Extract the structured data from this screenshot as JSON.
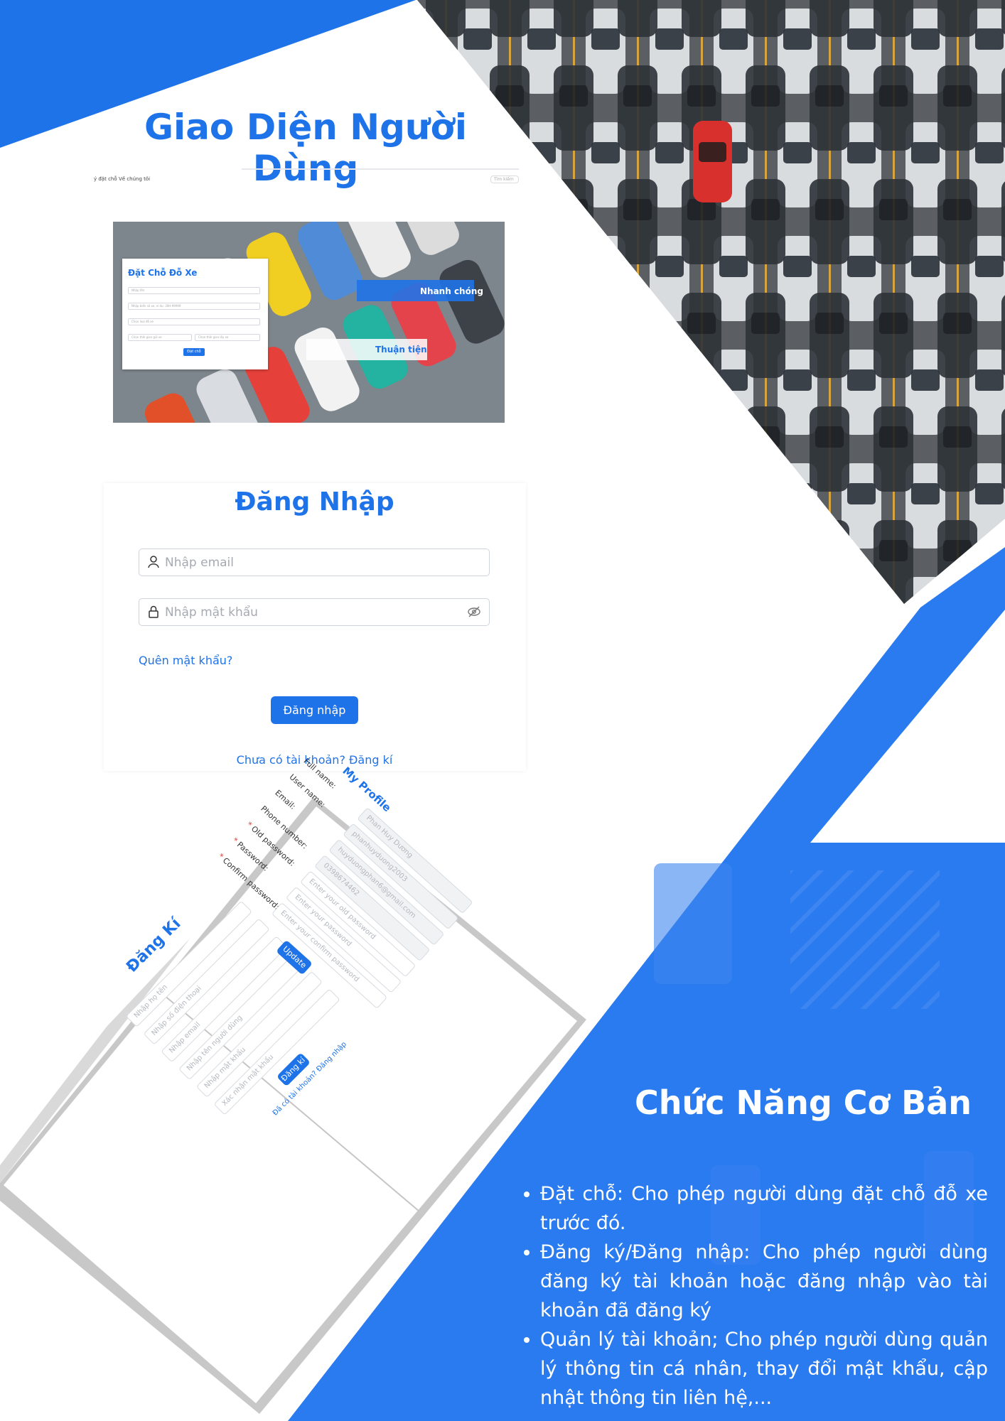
{
  "page_title": "Giao Diện Người Dùng",
  "colors": {
    "brand": "#1f73e9",
    "brand_band": "#2a7af0",
    "white": "#ffffff"
  },
  "nav": {
    "left_item_1": "ý đặt chỗ",
    "left_item_2": "Về chúng tôi",
    "search_placeholder": "Tìm kiếm"
  },
  "hero": {
    "form_title": "Đặt Chỗ Đỗ Xe",
    "field_1": "Nhập tên",
    "field_2": "Nhập biển số xe, ví dụ: 30H-99999",
    "field_3": "Chọn loại đỗ xe",
    "field_4a": "Chọn thời gian gửi xe",
    "field_4b": "Chọn thời gian lấy xe",
    "submit": "Đặt chỗ",
    "tag_fast": "Nhanh chóng",
    "tag_convenient": "Thuận tiện"
  },
  "login": {
    "title": "Đăng Nhập",
    "email_placeholder": "Nhập email",
    "password_placeholder": "Nhập mật khẩu",
    "forgot": "Quên mật khẩu?",
    "button": "Đăng nhập",
    "signup": "Chưa có tài khoản? Đăng kí"
  },
  "register": {
    "title": "Đăng Kí",
    "fields": [
      "Nhập họ tên",
      "Nhập số điện thoại",
      "Nhập email",
      "Nhập tên người dùng",
      "Nhập mật khẩu",
      "Xác nhận mật khẩu"
    ],
    "button": "Đăng kí",
    "login_link": "Đã có tài khoản? Đăng nhập"
  },
  "profile": {
    "title": "My Profile",
    "rows": [
      {
        "label": "Full name:",
        "value": "Phan Huy Dương",
        "required": false
      },
      {
        "label": "User name:",
        "value": "phanhuyduong2003",
        "required": false
      },
      {
        "label": "Email:",
        "value": "huyduongphan6@gmail.com",
        "required": false
      },
      {
        "label": "Phone number:",
        "value": "0398674462",
        "required": false
      },
      {
        "label": "Old password:",
        "value": "Enter your old password",
        "required": true
      },
      {
        "label": "Password:",
        "value": "Enter your password",
        "required": true
      },
      {
        "label": "Confirm password:",
        "value": "Enter your confirm password",
        "required": true
      }
    ],
    "button": "Update"
  },
  "features": {
    "title": "Chức Năng Cơ Bản",
    "items": [
      "Đặt chỗ: Cho phép người dùng đặt chỗ đỗ xe trước đó.",
      "Đăng ký/Đăng nhập: Cho phép người dùng đăng ký tài khoản hoặc đăng nhập vào tài khoản đã đăng ký",
      "Quản lý tài khoản; Cho phép người dùng quản lý thông tin cá nhân, thay đổi mật khẩu, cập nhật thông tin liên hệ,..."
    ]
  }
}
